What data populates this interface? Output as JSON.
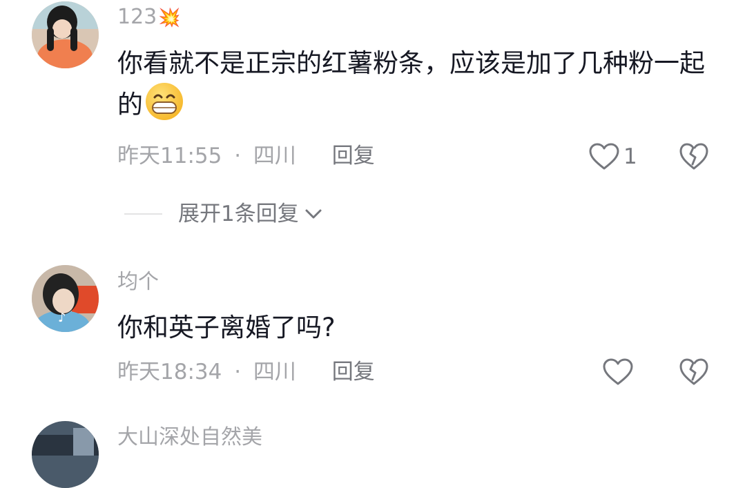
{
  "comments": [
    {
      "username": "123",
      "username_emoji": "💥",
      "text": "你看就不是正宗的红薯粉条，应该是加了几种粉一起的",
      "text_emoji": "😁",
      "time": "昨天11:55",
      "location": "四川",
      "reply_label": "回复",
      "like_count": "1",
      "replies_label": "展开1条回复"
    },
    {
      "username": "均个",
      "text": "你和英子离婚了吗?",
      "time": "昨天18:34",
      "location": "四川",
      "reply_label": "回复"
    },
    {
      "username": "大山深处自然美"
    }
  ],
  "meta_separator": "·",
  "colors": {
    "text": "#161823",
    "secondary": "#a4a5a9",
    "action": "#75777d"
  }
}
